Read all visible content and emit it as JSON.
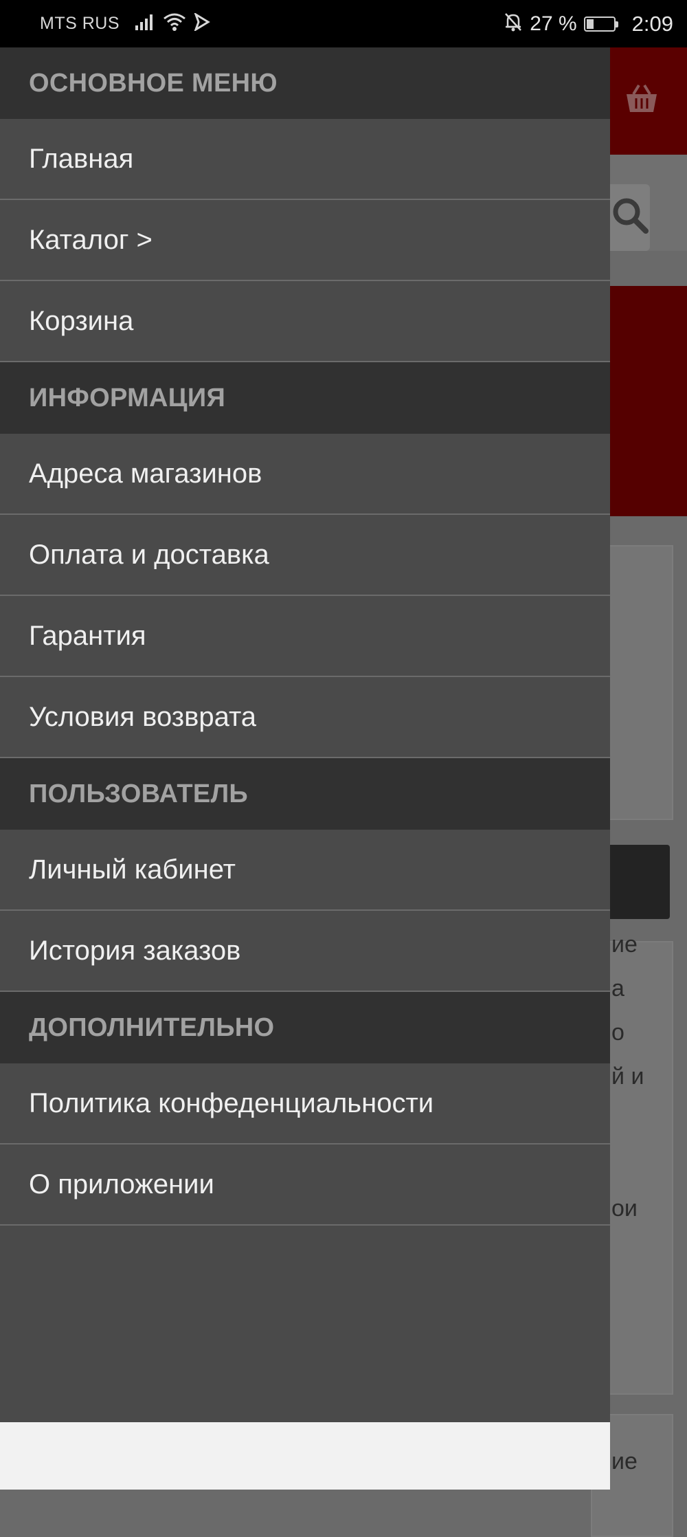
{
  "status_bar": {
    "carrier": "MTS RUS",
    "battery_percent": "27 %",
    "battery_level": 0.27,
    "time": "2:09",
    "icons": [
      "signal-icon",
      "wifi-icon",
      "send-icon",
      "bell-off-icon",
      "battery-icon"
    ]
  },
  "drawer": {
    "sections": [
      {
        "title": "ОСНОВНОЕ МЕНЮ",
        "items": [
          "Главная",
          "Каталог >",
          "Корзина"
        ]
      },
      {
        "title": "ИНФОРМАЦИЯ",
        "items": [
          "Адреса магазинов",
          "Оплата и доставка",
          "Гарантия",
          "Условия возврата"
        ]
      },
      {
        "title": "ПОЛЬЗОВАТЕЛЬ",
        "items": [
          "Личный кабинет",
          "История заказов"
        ]
      },
      {
        "title": "ДОПОЛНИТЕЛЬНО",
        "items": [
          "Политика конфеденциальности",
          "О приложении"
        ]
      }
    ]
  },
  "background": {
    "fragments": [
      "ие",
      "а",
      "о",
      "й и",
      "ои",
      "ие"
    ],
    "icons": [
      "basket-icon",
      "search-icon"
    ],
    "colors": {
      "header": "#5a0000",
      "drawer": "#4a4a4a",
      "section": "#313131"
    }
  }
}
